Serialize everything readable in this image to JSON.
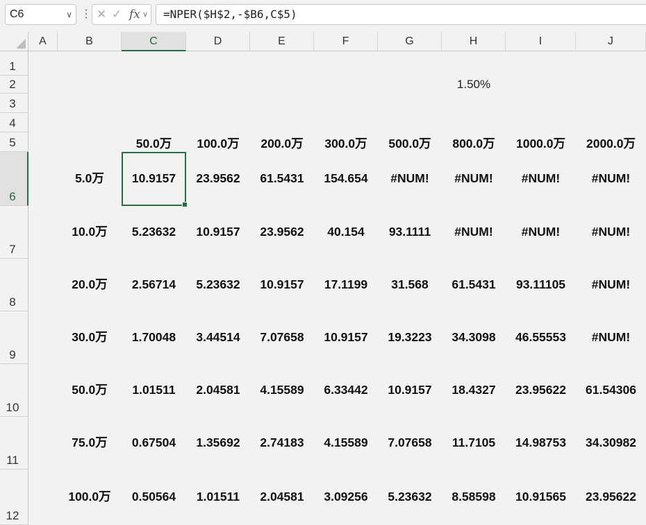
{
  "formula_bar": {
    "name_box": "C6",
    "formula": "=NPER($H$2,-$B6,C$5)"
  },
  "columns": [
    "A",
    "B",
    "C",
    "D",
    "E",
    "F",
    "G",
    "H",
    "I",
    "J"
  ],
  "selected_column": "C",
  "rows": [
    "1",
    "2",
    "3",
    "4",
    "5",
    "6",
    "7",
    "8",
    "9",
    "10",
    "11",
    "12"
  ],
  "selected_row": "6",
  "cells": {
    "H2": "1.50%",
    "row5": [
      "50.0万",
      "100.0万",
      "200.0万",
      "300.0万",
      "500.0万",
      "800.0万",
      "1000.0万",
      "2000.0万"
    ],
    "table": [
      {
        "b": "5.0万",
        "vals": [
          "10.9157",
          "23.9562",
          "61.5431",
          "154.654",
          "#NUM!",
          "#NUM!",
          "#NUM!",
          "#NUM!"
        ]
      },
      {
        "b": "10.0万",
        "vals": [
          "5.23632",
          "10.9157",
          "23.9562",
          "40.154",
          "93.1111",
          "#NUM!",
          "#NUM!",
          "#NUM!"
        ]
      },
      {
        "b": "20.0万",
        "vals": [
          "2.56714",
          "5.23632",
          "10.9157",
          "17.1199",
          "31.568",
          "61.5431",
          "93.11105",
          "#NUM!"
        ]
      },
      {
        "b": "30.0万",
        "vals": [
          "1.70048",
          "3.44514",
          "7.07658",
          "10.9157",
          "19.3223",
          "34.3098",
          "46.55553",
          "#NUM!"
        ]
      },
      {
        "b": "50.0万",
        "vals": [
          "1.01511",
          "2.04581",
          "4.15589",
          "6.33442",
          "10.9157",
          "18.4327",
          "23.95622",
          "61.54306"
        ]
      },
      {
        "b": "75.0万",
        "vals": [
          "0.67504",
          "1.35692",
          "2.74183",
          "4.15589",
          "7.07658",
          "11.7105",
          "14.98753",
          "34.30982"
        ]
      },
      {
        "b": "100.0万",
        "vals": [
          "0.50564",
          "1.01511",
          "2.04581",
          "3.09256",
          "5.23632",
          "8.58598",
          "10.91565",
          "23.95622"
        ]
      }
    ]
  },
  "icons": [
    "chevron-down-icon",
    "cancel-icon",
    "enter-icon",
    "fx-icon",
    "select-all-icon"
  ]
}
